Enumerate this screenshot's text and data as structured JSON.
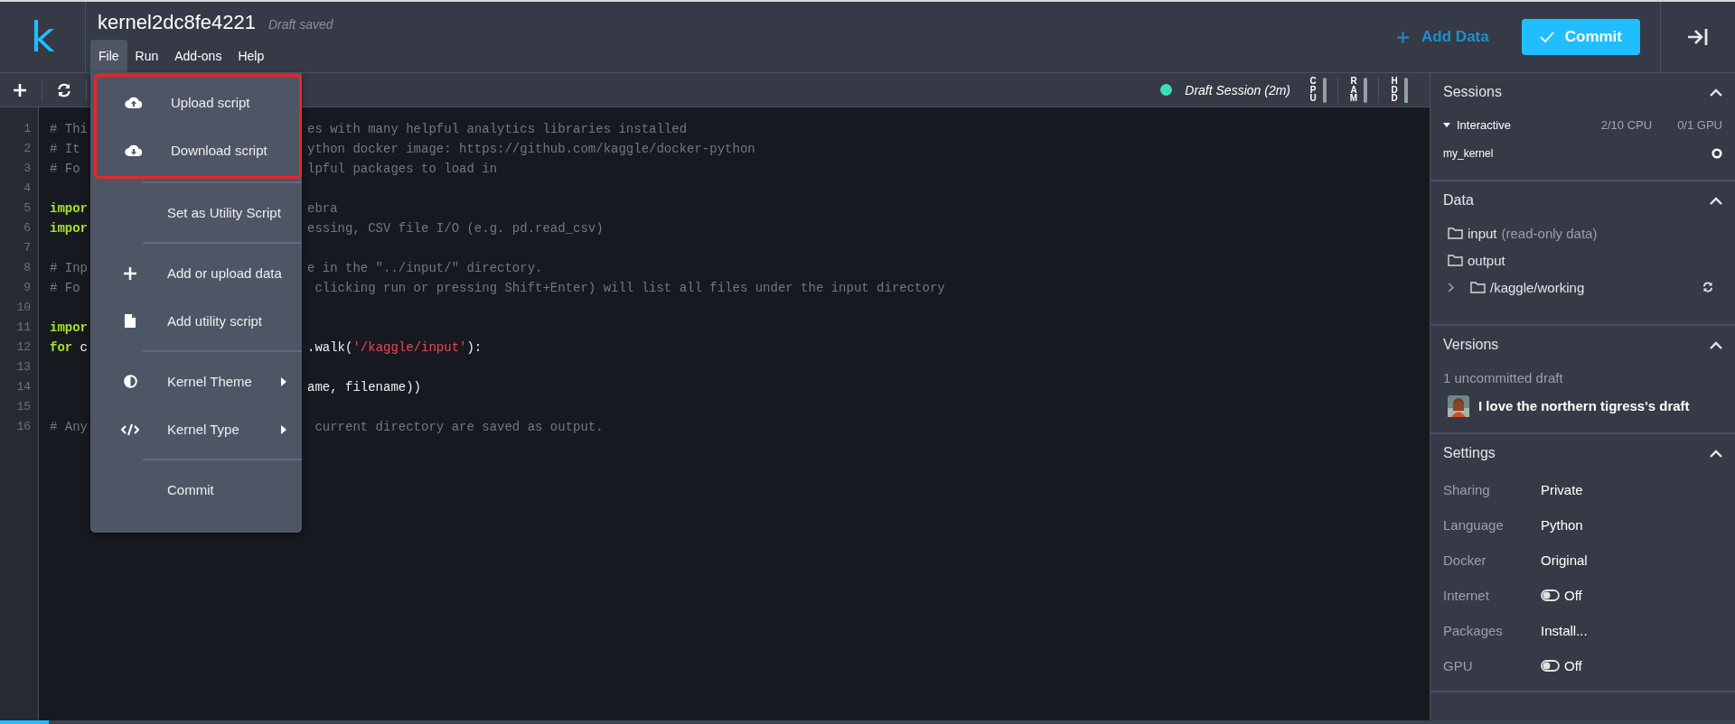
{
  "header": {
    "logo": "k",
    "title": "kernel2dc8fe4221",
    "save_status": "Draft saved",
    "add_data": "Add Data",
    "commit": "Commit"
  },
  "menu_bar": [
    {
      "label": "File",
      "selected": true
    },
    {
      "label": "Run",
      "selected": false
    },
    {
      "label": "Add-ons",
      "selected": false
    },
    {
      "label": "Help",
      "selected": false
    }
  ],
  "file_menu": [
    {
      "highlighted": true,
      "items": [
        {
          "label": "Upload script",
          "submenu": false
        },
        {
          "label": "Download script",
          "submenu": false
        }
      ]
    },
    {
      "highlighted": false,
      "items": [
        {
          "label": "Set as Utility Script",
          "submenu": false
        }
      ]
    },
    {
      "highlighted": false,
      "items": [
        {
          "label": "Add or upload data",
          "submenu": false
        },
        {
          "label": "Add utility script",
          "submenu": false
        }
      ]
    },
    {
      "highlighted": false,
      "items": [
        {
          "label": "Kernel Theme",
          "submenu": true
        },
        {
          "label": "Kernel Type",
          "submenu": true
        }
      ]
    },
    {
      "highlighted": false,
      "items": [
        {
          "label": "Commit",
          "submenu": false
        }
      ]
    }
  ],
  "session_status": {
    "label": "Draft Session (2m)",
    "color": "#3ddfb0"
  },
  "meters": [
    {
      "label": "CPU",
      "level": 0
    },
    {
      "label": "RAM",
      "level": 0
    },
    {
      "label": "HDD",
      "level": 0.06
    }
  ],
  "code_lines": [
    {
      "number": "1",
      "left": [
        {
          "kind": "comment",
          "text": "# Thi"
        }
      ],
      "right": [
        {
          "kind": "comment",
          "text": "es with many helpful analytics libraries installed"
        }
      ]
    },
    {
      "number": "2",
      "left": [
        {
          "kind": "comment",
          "text": "# It"
        }
      ],
      "right": [
        {
          "kind": "comment",
          "text": "ython docker image: https://github.com/kaggle/docker-python"
        }
      ]
    },
    {
      "number": "3",
      "left": [
        {
          "kind": "comment",
          "text": "# Fo"
        }
      ],
      "right": [
        {
          "kind": "comment",
          "text": "lpful packages to load in"
        }
      ]
    },
    {
      "number": "4"
    },
    {
      "number": "5",
      "left": [
        {
          "kind": "keyword",
          "text": "impor"
        }
      ],
      "right": [
        {
          "kind": "comment",
          "text": "ebra"
        }
      ]
    },
    {
      "number": "6",
      "left": [
        {
          "kind": "keyword",
          "text": "impor"
        }
      ],
      "right": [
        {
          "kind": "comment",
          "text": "essing, CSV file I/O (e.g. pd.read_csv)"
        }
      ]
    },
    {
      "number": "7"
    },
    {
      "number": "8",
      "left": [
        {
          "kind": "comment",
          "text": "# Inp"
        }
      ],
      "right": [
        {
          "kind": "comment",
          "text": "e in the \"../input/\" directory."
        }
      ]
    },
    {
      "number": "9",
      "left": [
        {
          "kind": "comment",
          "text": "# Fo"
        }
      ],
      "right": [
        {
          "kind": "comment",
          "text": " clicking run or pressing Shift+Enter) will list all files under the input directory"
        }
      ]
    },
    {
      "number": "10"
    },
    {
      "number": "11",
      "left": [
        {
          "kind": "keyword",
          "text": "impor"
        }
      ]
    },
    {
      "number": "12",
      "left": [
        {
          "kind": "keyword",
          "text": "for"
        },
        {
          "kind": "plain",
          "text": " c"
        }
      ],
      "right": [
        {
          "kind": "plain",
          "text": ".walk("
        },
        {
          "kind": "string",
          "text": "'/kaggle/input'"
        },
        {
          "kind": "plain",
          "text": "):"
        }
      ]
    },
    {
      "number": "13"
    },
    {
      "number": "14",
      "right": [
        {
          "kind": "plain",
          "text": "ame, filename))"
        }
      ]
    },
    {
      "number": "15"
    },
    {
      "number": "16",
      "left": [
        {
          "kind": "comment",
          "text": "# Any"
        }
      ],
      "right": [
        {
          "kind": "comment",
          "text": " current directory are saved as output."
        }
      ]
    }
  ],
  "sessions": {
    "title": "Sessions",
    "expanded": true,
    "name": "Interactive",
    "cpu": "2/10 CPU",
    "gpu": "0/1 GPU",
    "kernel": "my_kernel"
  },
  "data": {
    "title": "Data",
    "expanded": true,
    "items": [
      {
        "name": "input",
        "note": "(read-only data)",
        "expandable": false
      },
      {
        "name": "output",
        "expandable": false
      },
      {
        "name": "/kaggle/working",
        "expandable": true
      }
    ]
  },
  "versions": {
    "title": "Versions",
    "expanded": true,
    "summary": "1 uncommitted draft",
    "draft": "I love the northern tigress's draft"
  },
  "settings": {
    "title": "Settings",
    "expanded": true,
    "rows": [
      {
        "label": "Sharing",
        "kind": "text",
        "value": "Private"
      },
      {
        "label": "Language",
        "kind": "text",
        "value": "Python"
      },
      {
        "label": "Docker",
        "kind": "text",
        "value": "Original"
      },
      {
        "label": "Internet",
        "kind": "toggle",
        "on": false,
        "value": "Off"
      },
      {
        "label": "Packages",
        "kind": "text",
        "value": "Install..."
      },
      {
        "label": "GPU",
        "kind": "toggle",
        "on": false,
        "value": "Off"
      }
    ]
  },
  "bottom_bar": {
    "level": 0.028
  }
}
